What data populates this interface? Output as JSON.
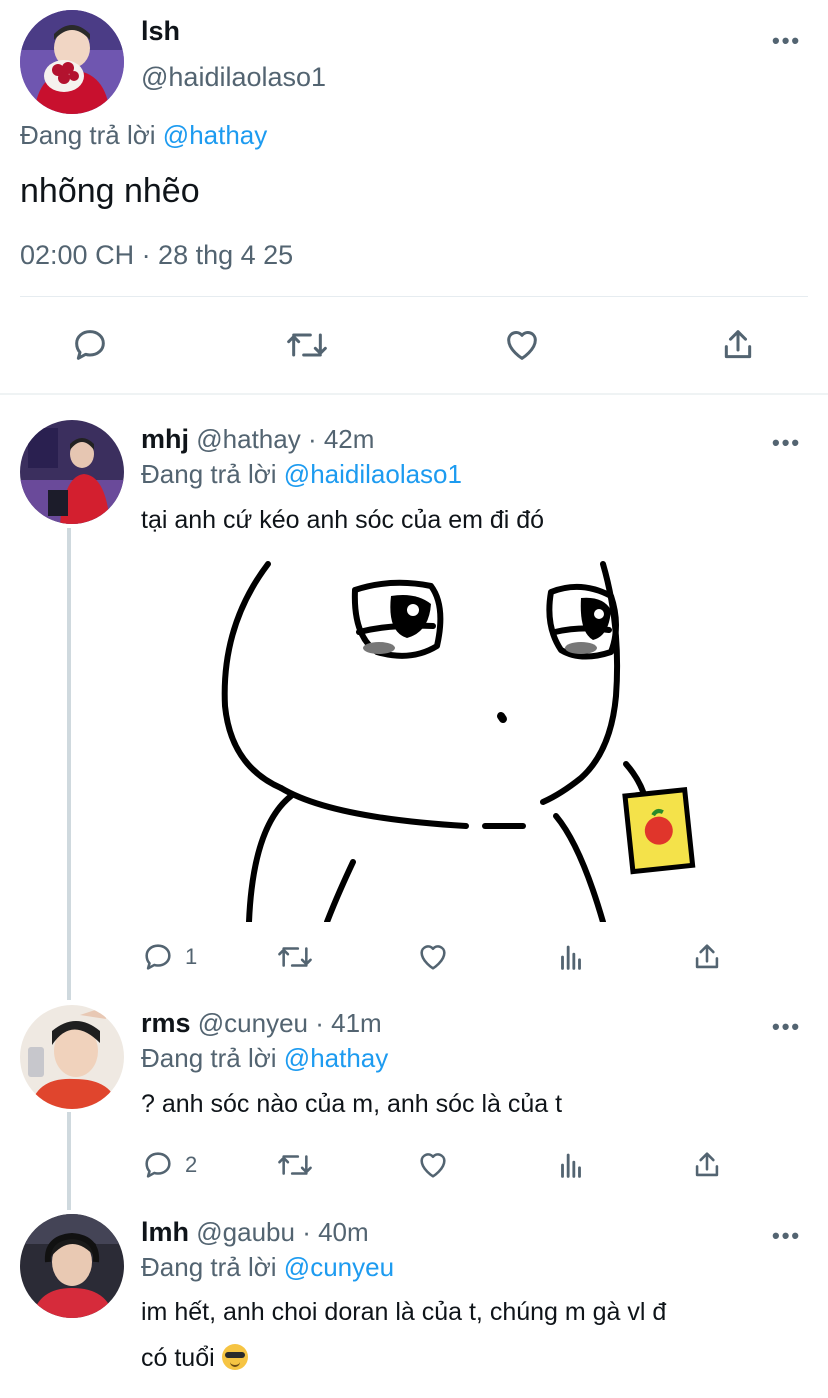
{
  "main_tweet": {
    "name": "lsh",
    "handle": "@haidilaolaso1",
    "replying_prefix": "Đang trả lời",
    "replying_to": "@hathay",
    "text": "nhõng nhẽo",
    "timestamp": "02:00 CH · 28 thg 4 25",
    "avatar_colors": [
      "#7a5ab5",
      "#d7263d",
      "#f3efe8"
    ]
  },
  "replies": [
    {
      "name": "mhj",
      "handle": "@hathay",
      "time": "· 42m",
      "replying_prefix": "Đang trả lời",
      "replying_to": "@haidilaolaso1",
      "text": "tại anh cứ kéo anh sóc của em đi đó",
      "reply_count": "1",
      "has_image": true
    },
    {
      "name": "rms",
      "handle": "@cunyeu",
      "time": "· 41m",
      "replying_prefix": "Đang trả lời",
      "replying_to": "@hathay",
      "text": "? anh sóc nào của m, anh sóc là của t",
      "reply_count": "2"
    },
    {
      "name": "lmh",
      "handle": "@gaubu",
      "time": "· 40m",
      "replying_prefix": "Đang trả lời",
      "replying_to": "@cunyeu",
      "text_line1": "im hết, anh choi doran là của t, chúng m gà vl đ",
      "text_line2": "có tuổi",
      "emoji": "smiling-face-with-sunglasses"
    }
  ],
  "colors": {
    "link": "#1d9bf0",
    "muted": "#536471",
    "divider": "#e6ecf0",
    "thread_line": "#cfd9de"
  }
}
